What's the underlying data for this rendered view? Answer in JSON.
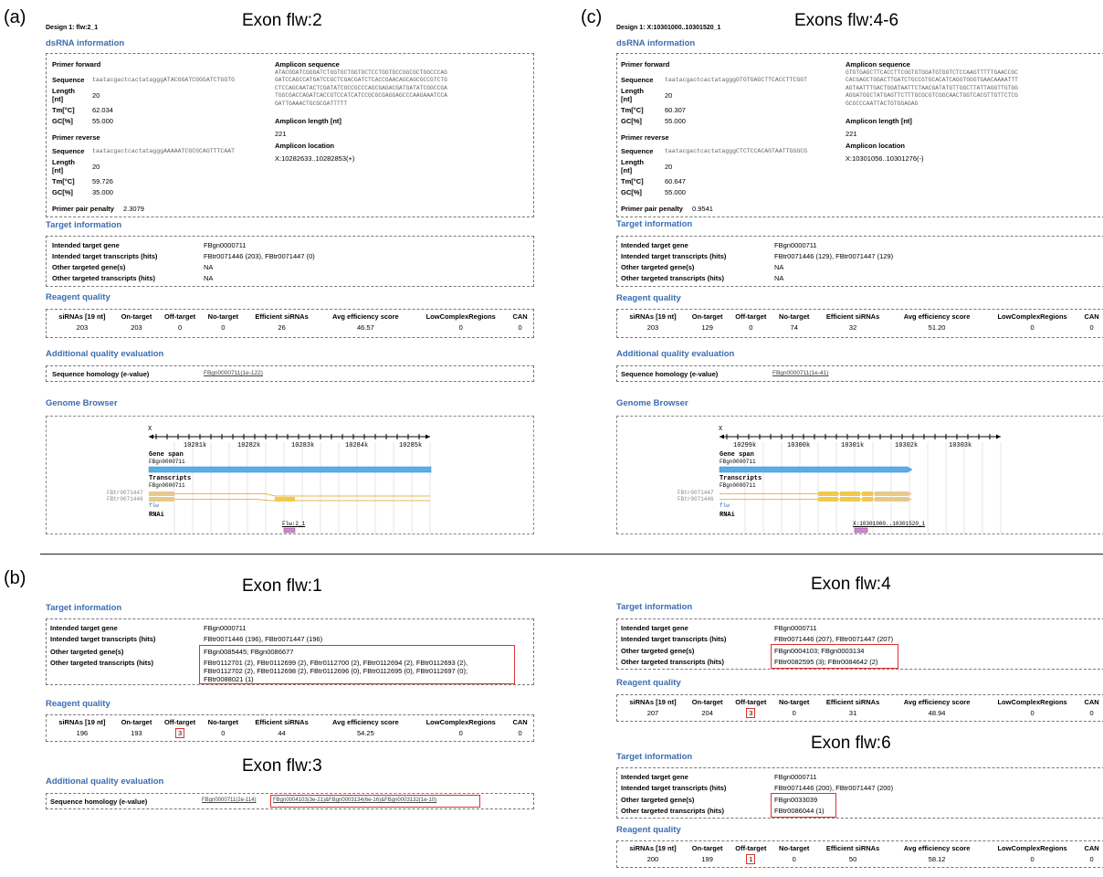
{
  "panel_labels": {
    "a": "(a)",
    "b": "(b)",
    "c": "(c)"
  },
  "a": {
    "design": "Design 1: flw:2_1",
    "title": "Exon flw:2",
    "dsrna_header": "dsRNA information",
    "primer_forward_label": "Primer forward",
    "sequence_label": "Sequence",
    "length_label": "Length",
    "length_unit": "[nt]",
    "tm_label": "Tm[°C]",
    "gc_label": "GC[%]",
    "primer_reverse_label": "Primer reverse",
    "fwd_sequence": "taatacgactcactatagggATACGGATCGGGATCTGGTG",
    "fwd_length": "20",
    "fwd_tm": "62.034",
    "fwd_gc": "55.000",
    "rev_sequence": "taatacgactcactatagggAAAAATCGCGCAGTTTCAAT",
    "rev_length": "20",
    "rev_tm": "59.726",
    "rev_gc": "35.000",
    "penalty_label": "Primer pair penalty",
    "penalty": "2.3079",
    "amplicon_seq_label": "Amplicon sequence",
    "amplicon_seq": "ATACGGATCGGGATCTGGTGCTGGTGCTCCTGGTGCCGGCGCTGGCCCAG\nGATCCAGCCATGATCCGCTCGACGATCTCACCGAACAGCAGCGCCGTCTG\nCTCCAGCAATACTCGATATCGCCGCCCAGCGAGACGATGATATCGGCCGA\nTGGCGACCAGATCACCGTCCATCATCCGCGCGAGGAGCCCAAGAAATCCA\nGATTGAAACTGCGCGATTTTT",
    "amplicon_len_label": "Amplicon length [nt]",
    "amplicon_len": "221",
    "amplicon_loc_label": "Amplicon location",
    "amplicon_loc": "X:10282633..10282853(+)",
    "target_header": "Target information",
    "t_gene_label": "Intended target gene",
    "t_gene": "FBgn0000711",
    "t_tx_label": "Intended target transcripts (hits)",
    "t_tx": "FBtr0071446 (203), FBtr0071447 (0)",
    "o_gene_label": "Other targeted gene(s)",
    "o_gene": "NA",
    "o_tx_label": "Other targeted transcripts (hits)",
    "o_tx": "NA",
    "reagent_header": "Reagent quality",
    "rq_values": [
      "203",
      "203",
      "0",
      "0",
      "26",
      "46.57",
      "0",
      "0"
    ],
    "addq_header": "Additional quality evaluation",
    "hom_label": "Sequence homology (e-value)",
    "hom_value": "FBgn0000711(1e-122)",
    "gb_header": "Genome Browser",
    "gb": {
      "chrom": "X",
      "ticks": [
        "10281k",
        "10282k",
        "10283k",
        "10284k",
        "10285k"
      ],
      "gene_span": "Gene span",
      "gene_id": "FBgn0000711",
      "transcripts": "Transcripts",
      "tx_gene": "FBgn0000711",
      "tx1": "FBtr0071447",
      "tx2": "FBtr0071446",
      "flw": "flw",
      "rnai": "RNAi",
      "rnai_name": "Flw:2_1"
    }
  },
  "c": {
    "design": "Design 1: X:10301000..10301520_1",
    "title": "Exons flw:4-6",
    "dsrna_header": "dsRNA information",
    "primer_forward_label": "Primer forward",
    "sequence_label": "Sequence",
    "length_label": "Length",
    "length_unit": "[nt]",
    "tm_label": "Tm[°C]",
    "gc_label": "GC[%]",
    "primer_reverse_label": "Primer reverse",
    "fwd_sequence": "taatacgactcactatagggGTGTGAGCTTCACCTTCGGT",
    "fwd_length": "20",
    "fwd_tm": "60.307",
    "fwd_gc": "55.000",
    "rev_sequence": "taatacgactcactatagggCTCTCCACAGTAATTGGGCG",
    "rev_length": "20",
    "rev_tm": "60.647",
    "rev_gc": "55.000",
    "penalty_label": "Primer pair penalty",
    "penalty": "0.9541",
    "amplicon_seq_label": "Amplicon sequence",
    "amplicon_seq": "GTGTGAGCTTCACCTTCGGTGTGGATGTGGTCTCCAAGTTTTTGAACCGC\nCACGAGCTGGACTTGATCTGCCGTGCACATCAGGTGGGTGAACAAAATTT\nAGTAATTTGACTGGATAATTCTAACGATATGTTGGCTTATTAGGTTGTGG\nAGGATGGCTATGAGTTCTTTGCGCGTCGGCAACTGGTCACGTTGTTCTCG\nGCGCCCAATTACTGTGGAGAG",
    "amplicon_len_label": "Amplicon length [nt]",
    "amplicon_len": "221",
    "amplicon_loc_label": "Amplicon location",
    "amplicon_loc": "X:10301056..10301276(-)",
    "target_header": "Target information",
    "t_gene_label": "Intended target gene",
    "t_gene": "FBgn0000711",
    "t_tx_label": "Intended target transcripts (hits)",
    "t_tx": "FBtr0071446 (129), FBtr0071447 (129)",
    "o_gene_label": "Other targeted gene(s)",
    "o_gene": "NA",
    "o_tx_label": "Other targeted transcripts (hits)",
    "o_tx": "NA",
    "reagent_header": "Reagent quality",
    "rq_values": [
      "203",
      "129",
      "0",
      "74",
      "32",
      "51.20",
      "0",
      "0"
    ],
    "addq_header": "Additional quality evaluation",
    "hom_label": "Sequence homology (e-value)",
    "hom_value": "FBgn0000711(1e-41)",
    "gb_header": "Genome Browser",
    "gb": {
      "chrom": "X",
      "ticks": [
        "10299k",
        "10300k",
        "10301k",
        "10302k",
        "10303k"
      ],
      "gene_span": "Gene span",
      "gene_id": "FBgn0000711",
      "transcripts": "Transcripts",
      "tx_gene": "FBgn0000711",
      "tx1": "FBtr0071447",
      "tx2": "FBtr0071446",
      "flw": "flw",
      "rnai": "RNAi",
      "rnai_name": "X:10301000..10301520_1"
    }
  },
  "rq_headers": [
    "siRNAs [19 nt]",
    "On-target",
    "Off-target",
    "No-target",
    "Efficient siRNAs",
    "Avg efficiency score",
    "LowComplexRegions",
    "CAN"
  ],
  "b1": {
    "title": "Exon flw:1",
    "target_header": "Target information",
    "t_gene_label": "Intended target gene",
    "t_gene": "FBgn0000711",
    "t_tx_label": "Intended target transcripts (hits)",
    "t_tx": "FBtr0071446 (196), FBtr0071447 (196)",
    "o_gene_label": "Other targeted gene(s)",
    "o_gene": "FBgn0085445; FBgn0086677",
    "o_tx_label": "Other targeted transcripts (hits)",
    "o_tx_1": "FBtr0112701 (2), FBtr0112699 (2), FBtr0112700 (2), FBtr0112694 (2), FBtr0112693 (2),",
    "o_tx_2": "FBtr0112702 (2), FBtr0112698 (2), FBtr0112696 (0), FBtr0112695 (0), FBtr0112697 (0);",
    "o_tx_3": "FBtr0088021 (1)",
    "reagent_header": "Reagent quality",
    "rq_values": [
      "196",
      "193",
      "3",
      "0",
      "44",
      "54.25",
      "0",
      "0"
    ]
  },
  "b3": {
    "title": "Exon flw:3",
    "addq_header": "Additional quality evaluation",
    "hom_label": "Sequence homology (e-value)",
    "hom_a": "FBgn0000711(2e-114)",
    "hom_b": "FBgn0004103(3e-21)&FBgn0003134(6e-16)&FBgn0003132(1e-10)"
  },
  "b4": {
    "title": "Exon flw:4",
    "target_header": "Target information",
    "t_gene_label": "Intended target gene",
    "t_gene": "FBgn0000711",
    "t_tx_label": "Intended target transcripts (hits)",
    "t_tx": "FBtr0071446 (207), FBtr0071447 (207)",
    "o_gene_label": "Other targeted gene(s)",
    "o_gene": "FBgn0004103; FBgn0003134",
    "o_tx_label": "Other targeted transcripts (hits)",
    "o_tx": "FBtr0082595 (3); FBtr0084642 (2)",
    "reagent_header": "Reagent quality",
    "rq_values": [
      "207",
      "204",
      "3",
      "0",
      "31",
      "48.94",
      "0",
      "0"
    ]
  },
  "b6": {
    "title": "Exon flw:6",
    "target_header": "Target information",
    "t_gene_label": "Intended target gene",
    "t_gene": "FBgn0000711",
    "t_tx_label": "Intended target transcripts (hits)",
    "t_tx": "FBtr0071446 (200), FBtr0071447 (200)",
    "o_gene_label": "Other targeted gene(s)",
    "o_gene": "FBgn0033039",
    "o_tx_label": "Other targeted transcripts (hits)",
    "o_tx": "FBtr0086044 (1)",
    "reagent_header": "Reagent quality",
    "rq_values": [
      "200",
      "199",
      "1",
      "0",
      "50",
      "58.12",
      "0",
      "0"
    ]
  }
}
